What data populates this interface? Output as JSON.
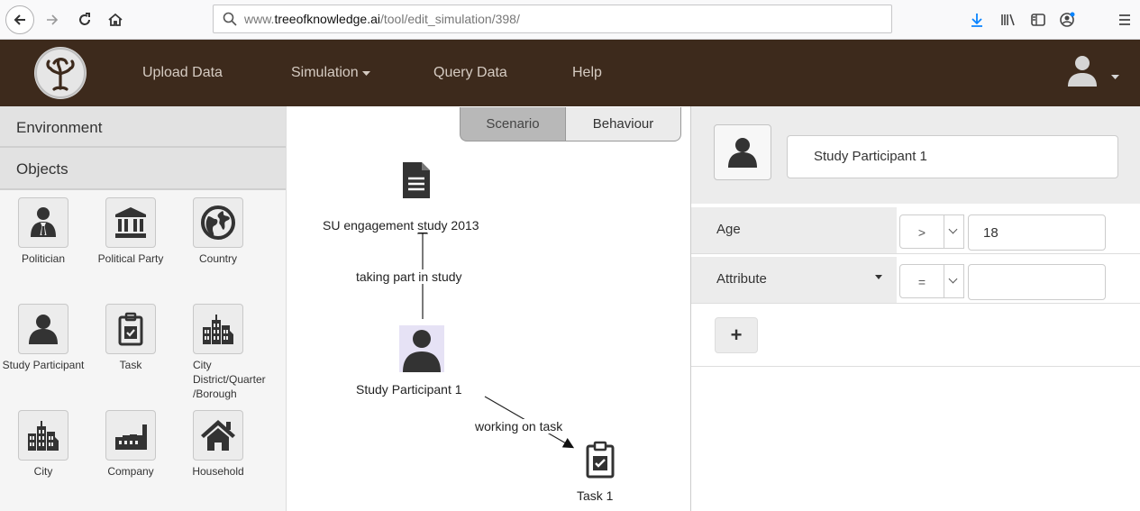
{
  "browser": {
    "url_prefix": "www.",
    "url_host": "treeofknowledge.ai",
    "url_path": "/tool/edit_simulation/398/"
  },
  "navbar": {
    "upload": "Upload Data",
    "simulation": "Simulation",
    "query": "Query Data",
    "help": "Help",
    "colors": {
      "background": "#3d2a1c",
      "link": "#d5cbc2"
    }
  },
  "sidebar": {
    "environment": "Environment",
    "objects": "Objects",
    "items": [
      {
        "label": "Politician",
        "icon": "politician-icon"
      },
      {
        "label": "Political Party",
        "icon": "institution-icon"
      },
      {
        "label": "Country",
        "icon": "globe-icon"
      },
      {
        "label": "Study Participant",
        "icon": "person-icon"
      },
      {
        "label": "Task",
        "icon": "clipboard-check-icon"
      },
      {
        "label": "City District/Quarter /Borough",
        "icon": "buildings-icon"
      },
      {
        "label": "City",
        "icon": "buildings-icon"
      },
      {
        "label": "Company",
        "icon": "factory-icon"
      },
      {
        "label": "Household",
        "icon": "house-icon"
      }
    ]
  },
  "canvas": {
    "tab_scenario": "Scenario",
    "tab_behaviour": "Behaviour",
    "nodes": [
      {
        "label": "SU engagement study 2013",
        "icon": "document-icon"
      },
      {
        "label": "Study Participant 1",
        "icon": "person-icon"
      },
      {
        "label": "Task 1",
        "icon": "clipboard-check-icon"
      }
    ],
    "edges": [
      {
        "label": "taking part in study"
      },
      {
        "label": "working on task"
      }
    ]
  },
  "panel": {
    "object_name": "Study Participant 1",
    "conditions": [
      {
        "attribute": "Age",
        "operator": ">",
        "value": "18"
      },
      {
        "attribute": "Attribute",
        "operator": "=",
        "value": ""
      }
    ],
    "add_label": "+"
  }
}
